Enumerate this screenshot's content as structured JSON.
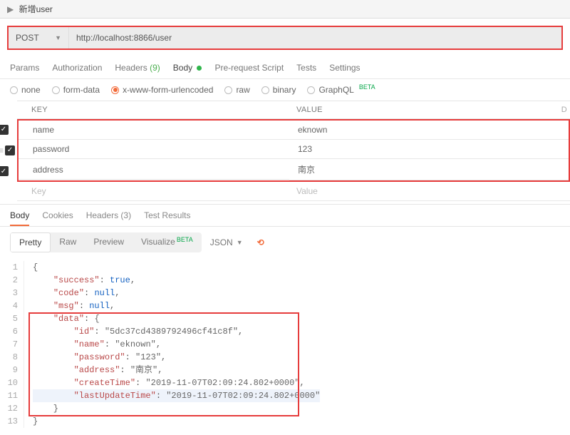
{
  "tabTitle": "新增user",
  "method": "POST",
  "url": "http://localhost:8866/user",
  "reqTabs": {
    "params": "Params",
    "auth": "Authorization",
    "headers": "Headers",
    "headersCount": "(9)",
    "body": "Body",
    "prereq": "Pre-request Script",
    "tests": "Tests",
    "settings": "Settings"
  },
  "bodyTypes": {
    "none": "none",
    "formData": "form-data",
    "urlencoded": "x-www-form-urlencoded",
    "raw": "raw",
    "binary": "binary",
    "graphql": "GraphQL",
    "beta": "BETA"
  },
  "kvHeaders": {
    "key": "KEY",
    "value": "VALUE",
    "desc": "D"
  },
  "kvRows": [
    {
      "key": "name",
      "value": "eknown"
    },
    {
      "key": "password",
      "value": "123"
    },
    {
      "key": "address",
      "value": "南京"
    }
  ],
  "kvPlaceholder": {
    "key": "Key",
    "value": "Value"
  },
  "respTabs": {
    "body": "Body",
    "cookies": "Cookies",
    "headers": "Headers",
    "headersCount": "(3)",
    "testResults": "Test Results"
  },
  "viewModes": {
    "pretty": "Pretty",
    "raw": "Raw",
    "preview": "Preview",
    "visualize": "Visualize",
    "beta": "BETA",
    "format": "JSON"
  },
  "jsonLines": [
    "{",
    "    \"success\": true,",
    "    \"code\": null,",
    "    \"msg\": null,",
    "    \"data\": {",
    "        \"id\": \"5dc37cd4389792496cf41c8f\",",
    "        \"name\": \"eknown\",",
    "        \"password\": \"123\",",
    "        \"address\": \"南京\",",
    "        \"createTime\": \"2019-11-07T02:09:24.802+0000\",",
    "        \"lastUpdateTime\": \"2019-11-07T02:09:24.802+0000\"",
    "    }",
    "}"
  ]
}
